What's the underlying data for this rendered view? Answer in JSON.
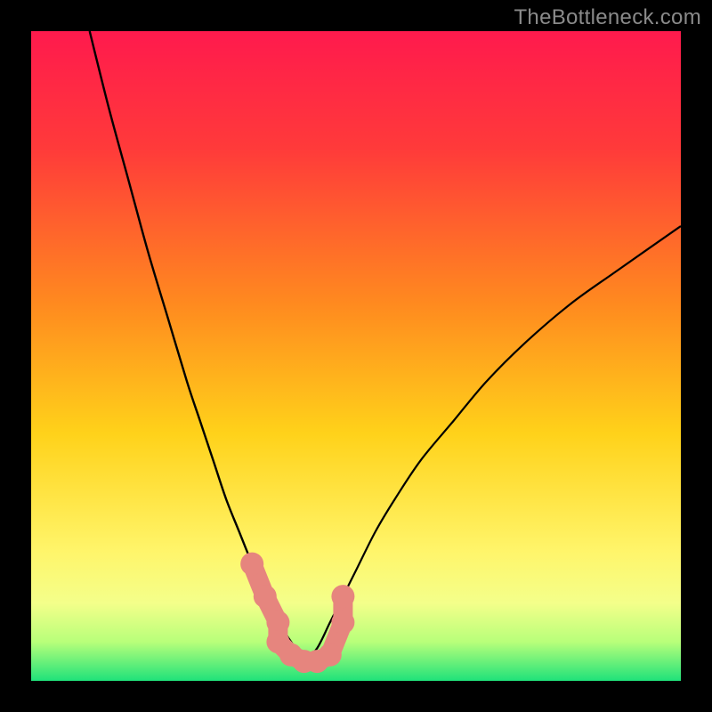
{
  "watermark": "TheBottleneck.com",
  "colors": {
    "frame": "#000000",
    "gradient_top": "#ff1a4d",
    "gradient_mid1": "#ff6a1f",
    "gradient_mid2": "#ffd21a",
    "gradient_mid3": "#fff56a",
    "gradient_bottom": "#1fe27a",
    "curve": "#000000",
    "marker_fill": "#e6857e",
    "marker_stroke": "#d06a63"
  },
  "chart_data": {
    "type": "line",
    "title": "",
    "xlabel": "",
    "ylabel": "",
    "xlim": [
      0,
      100
    ],
    "ylim": [
      0,
      100
    ],
    "series": [
      {
        "name": "left-curve",
        "x": [
          9,
          12,
          15,
          18,
          21,
          24,
          26,
          28,
          30,
          32,
          34,
          36,
          38,
          40,
          42
        ],
        "y": [
          100,
          88,
          77,
          66,
          56,
          46,
          40,
          34,
          28,
          23,
          18,
          13,
          9,
          6,
          3
        ]
      },
      {
        "name": "right-curve",
        "x": [
          42,
          44,
          46,
          48,
          50,
          53,
          56,
          60,
          65,
          70,
          76,
          83,
          90,
          100
        ],
        "y": [
          3,
          5,
          9,
          13,
          17,
          23,
          28,
          34,
          40,
          46,
          52,
          58,
          63,
          70
        ]
      }
    ],
    "markers": {
      "name": "bottleneck-range",
      "points": [
        {
          "x": 34,
          "y": 18
        },
        {
          "x": 36,
          "y": 13
        },
        {
          "x": 38,
          "y": 9
        },
        {
          "x": 38,
          "y": 6
        },
        {
          "x": 40,
          "y": 4
        },
        {
          "x": 42,
          "y": 3
        },
        {
          "x": 44,
          "y": 3
        },
        {
          "x": 46,
          "y": 4
        },
        {
          "x": 48,
          "y": 9
        },
        {
          "x": 48,
          "y": 13
        }
      ]
    },
    "gradient_stops": [
      {
        "offset": 0.0,
        "color": "#ff1a4d"
      },
      {
        "offset": 0.18,
        "color": "#ff3a3a"
      },
      {
        "offset": 0.42,
        "color": "#ff8a1f"
      },
      {
        "offset": 0.62,
        "color": "#ffd21a"
      },
      {
        "offset": 0.8,
        "color": "#fff56a"
      },
      {
        "offset": 0.88,
        "color": "#f4ff8a"
      },
      {
        "offset": 0.94,
        "color": "#b8ff7a"
      },
      {
        "offset": 1.0,
        "color": "#1fe27a"
      }
    ]
  }
}
